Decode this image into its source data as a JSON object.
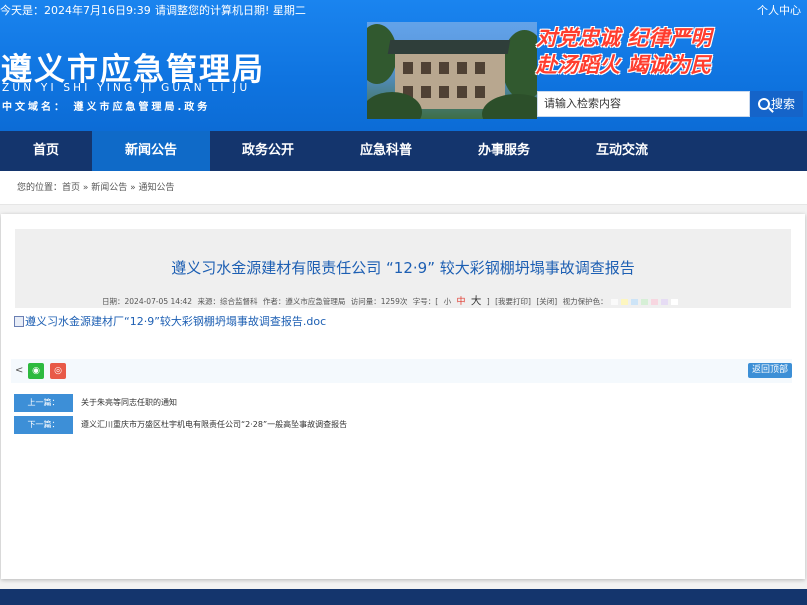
{
  "topbar": {
    "date_text": "今天是：2024年7月16日9:39",
    "calibrate_text": "请调整您的计算机日期! 星期二",
    "user_center": "个人中心"
  },
  "site": {
    "title": "遵义市应急管理局",
    "pinyin": "ZUN YI SHI YING JI GUAN LI JU",
    "domain": "中文域名： 遵义市应急管理局.政务"
  },
  "slogan": {
    "line1": "对党忠诚 纪律严明",
    "line2": "赴汤蹈火 竭诚为民"
  },
  "search": {
    "placeholder": "请输入检索内容",
    "button_label": "搜索"
  },
  "nav": {
    "items": [
      {
        "label": "首页"
      },
      {
        "label": "新闻公告"
      },
      {
        "label": "政务公开"
      },
      {
        "label": "应急科普"
      },
      {
        "label": "办事服务"
      },
      {
        "label": "互动交流"
      }
    ],
    "active_index": 1
  },
  "breadcrumb": {
    "text": "您的位置：首页 » 新闻公告 » 通知公告"
  },
  "article": {
    "title": "遵义习水金源建材有限责任公司 “12·9” 较大彩钢棚坍塌事故调查报告",
    "meta": {
      "date": "日期：2024-07-05 14:42",
      "source": "来源：综合监督科",
      "author": "作者：遵义市应急管理局",
      "views": "访问量：1259次",
      "fontsize_label": "字号：[",
      "font_small": "小",
      "font_medium": "中",
      "font_large": "大",
      "fontsize_end": "]",
      "print": "[我要打印]",
      "close": "[关闭]",
      "eye_protect": "视力保护色："
    },
    "eye_colors": [
      "#fafafa",
      "#fdf6c0",
      "#cde4f7",
      "#d6efd6",
      "#f7d6e0",
      "#e6dcf4",
      "#ffffff"
    ],
    "attachment": "遵义习水金源建材厂“12·9”较大彩钢棚坍塌事故调查报告.doc"
  },
  "share": {
    "back_to_top": "返回顶部"
  },
  "prevnext": {
    "prev_label": "上一篇：",
    "prev_title": "关于朱亮等同志任职的通知",
    "next_label": "下一篇：",
    "next_title": "遵义汇川重庆市万盛区杜宇机电有限责任公司“2·28”一般高坠事故调查报告"
  },
  "colors": {
    "header_blue": "#1a84ef",
    "nav_dark": "#14356d",
    "nav_active": "#0f6ac8",
    "title_blue": "#1d5fb3",
    "slogan_red": "#ff3d2e"
  }
}
